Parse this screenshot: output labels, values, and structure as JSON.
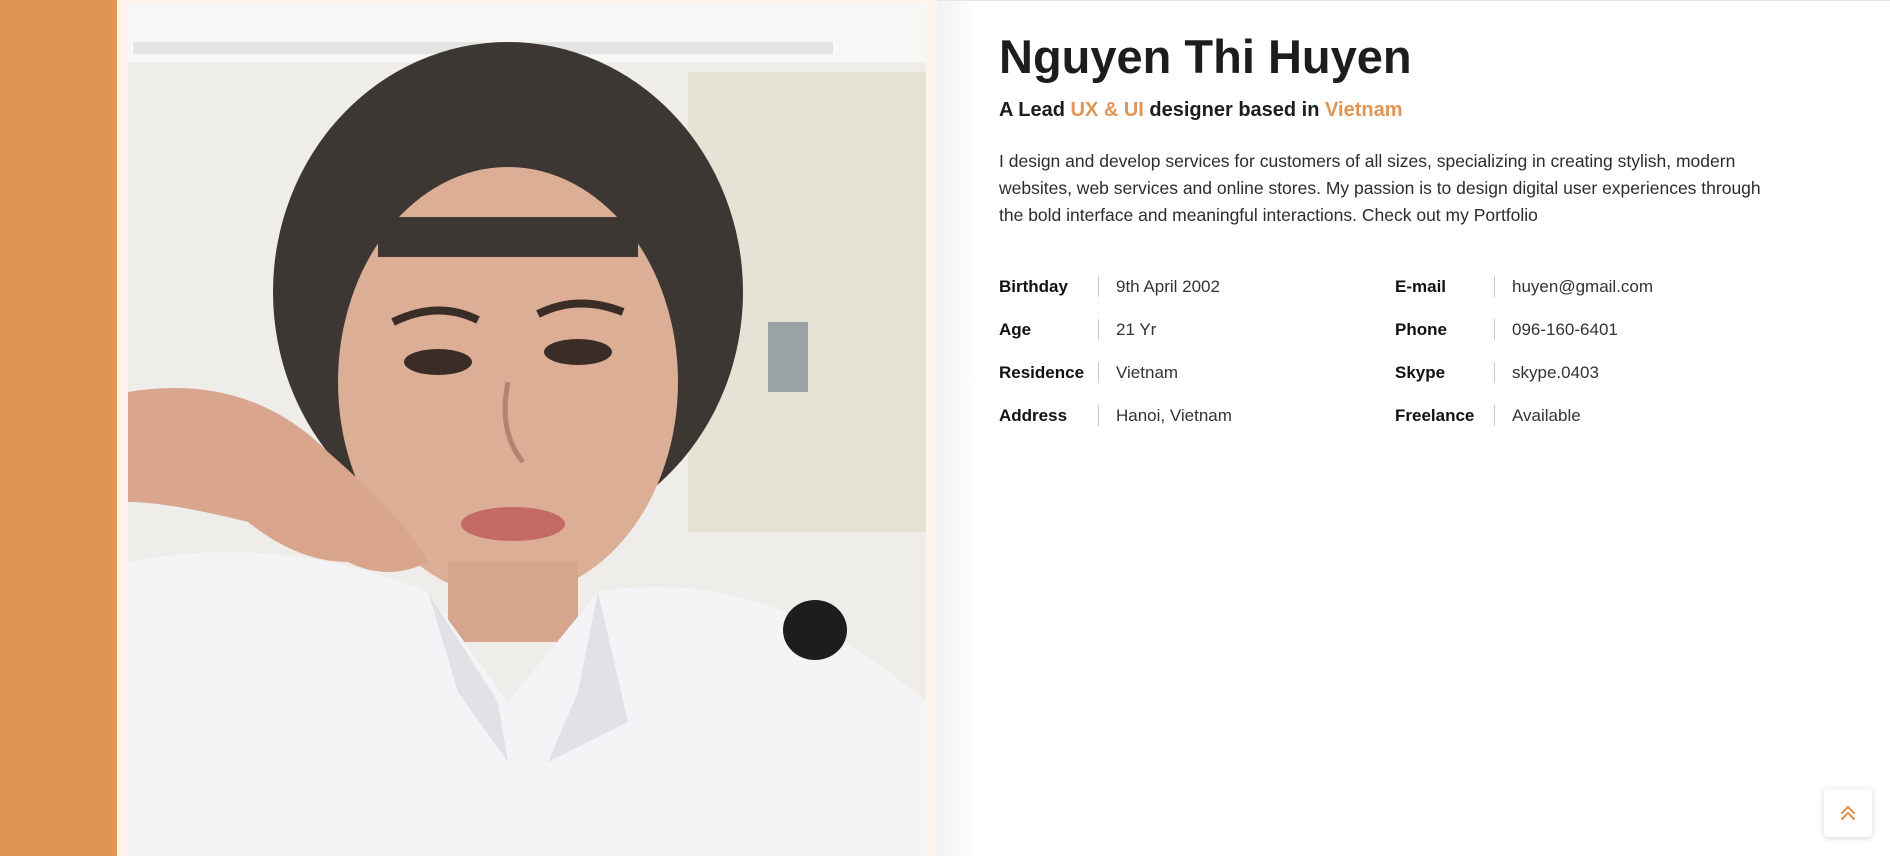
{
  "profile": {
    "name": "Nguyen Thi Huyen",
    "subtitle_prefix": "A Lead",
    "subtitle_skill": "UX & UI",
    "subtitle_middle": "designer based in",
    "subtitle_location": "Vietnam",
    "bio": "I design and develop services for customers of all sizes, specializing in creating stylish, modern websites, web services and online stores. My passion is to design digital user experiences through the bold interface and meaningful interactions. Check out my Portfolio"
  },
  "info_left": [
    {
      "label": "Birthday",
      "value": "9th April 2002"
    },
    {
      "label": "Age",
      "value": "21 Yr"
    },
    {
      "label": "Residence",
      "value": "Vietnam"
    },
    {
      "label": "Address",
      "value": "Hanoi, Vietnam"
    }
  ],
  "info_right": [
    {
      "label": "E-mail",
      "value": "huyen@gmail.com"
    },
    {
      "label": "Phone",
      "value": "096-160-6401"
    },
    {
      "label": "Skype",
      "value": "skype.0403"
    },
    {
      "label": "Freelance",
      "value": "Available"
    }
  ],
  "icons": {
    "scroll_top": "double-chevron-up-icon"
  },
  "colors": {
    "accent": "#e09554",
    "frame": "#fff3ea",
    "text": "#1d1d1d"
  }
}
